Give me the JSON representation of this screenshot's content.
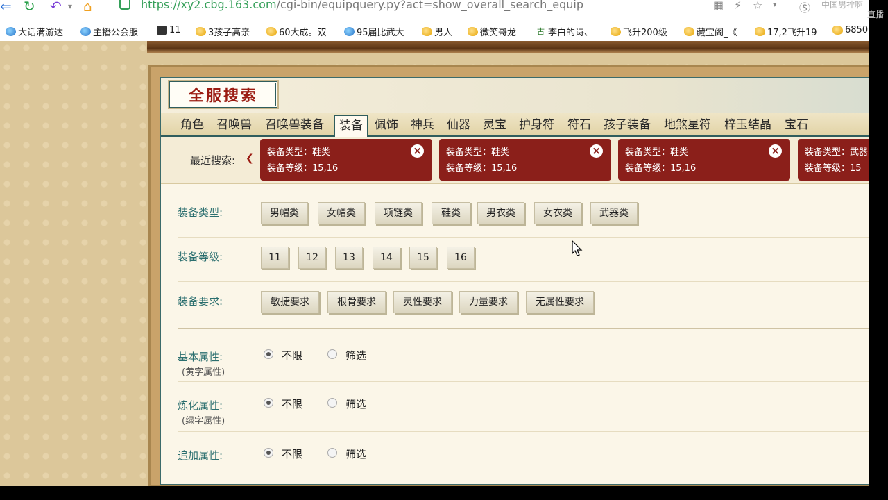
{
  "browser": {
    "url_host": "https://xy2.cbg.163.com",
    "url_path": "/cgi-bin/equipquery.py?act=show_overall_search_equip",
    "site_name": "中国男排啊",
    "corner_text": "直播"
  },
  "bookmarks": [
    {
      "label": "大话满游达",
      "icon": "ie-icon"
    },
    {
      "label": "主播公会服",
      "icon": "ie-icon"
    },
    {
      "label": "11",
      "icon": "dark-square-icon"
    },
    {
      "label": "3孩子高亲",
      "icon": "bird-icon"
    },
    {
      "label": "60大成。双",
      "icon": "bird-icon"
    },
    {
      "label": "95届比武大",
      "icon": "ie-icon"
    },
    {
      "label": "男人",
      "icon": "bird-icon"
    },
    {
      "label": "微笑哥龙",
      "icon": "bird-icon"
    },
    {
      "label": "李白的诗、",
      "icon": "gu-icon"
    },
    {
      "label": "飞升200级",
      "icon": "bird-icon"
    },
    {
      "label": "藏宝阁_《",
      "icon": "bird-icon"
    },
    {
      "label": "17,2飞升19",
      "icon": "bird-icon"
    },
    {
      "label": "6850",
      "icon": "bird-icon"
    }
  ],
  "page": {
    "title": "全服搜索",
    "tabs": [
      "角色",
      "召唤兽",
      "召唤兽装备",
      "装备",
      "佩饰",
      "神兵",
      "仙器",
      "灵宝",
      "护身符",
      "符石",
      "孩子装备",
      "地煞星符",
      "梓玉结晶",
      "宝石"
    ],
    "active_tab": "装备",
    "recent_label": "最近搜索:",
    "recent": [
      {
        "line1": "装备类型：鞋类",
        "line2": "装备等级：15,16"
      },
      {
        "line1": "装备类型：鞋类",
        "line2": "装备等级：15,16"
      },
      {
        "line1": "装备类型：鞋类",
        "line2": "装备等级：15,16"
      },
      {
        "line1": "装备类型：武器",
        "line2": "装备等级：15"
      }
    ],
    "filters": {
      "type": {
        "label": "装备类型:",
        "options": [
          "男帽类",
          "女帽类",
          "项链类",
          "鞋类",
          "男衣类",
          "女衣类",
          "武器类"
        ]
      },
      "level": {
        "label": "装备等级:",
        "options": [
          "11",
          "12",
          "13",
          "14",
          "15",
          "16"
        ]
      },
      "req": {
        "label": "装备要求:",
        "options": [
          "敏捷要求",
          "根骨要求",
          "灵性要求",
          "力量要求",
          "无属性要求"
        ]
      }
    },
    "attrs": [
      {
        "label": "基本属性:",
        "sub": "(黄字属性)",
        "opt1": "不限",
        "opt2": "筛选",
        "selected": "不限"
      },
      {
        "label": "炼化属性:",
        "sub": "(绿字属性)",
        "opt1": "不限",
        "opt2": "筛选",
        "selected": "不限"
      },
      {
        "label": "追加属性:",
        "sub": "",
        "opt1": "不限",
        "opt2": "筛选",
        "selected": "不限"
      }
    ]
  },
  "colors": {
    "accent_red": "#8b1f1a",
    "teal": "#2b6f6f",
    "url_green": "#36a05a"
  }
}
